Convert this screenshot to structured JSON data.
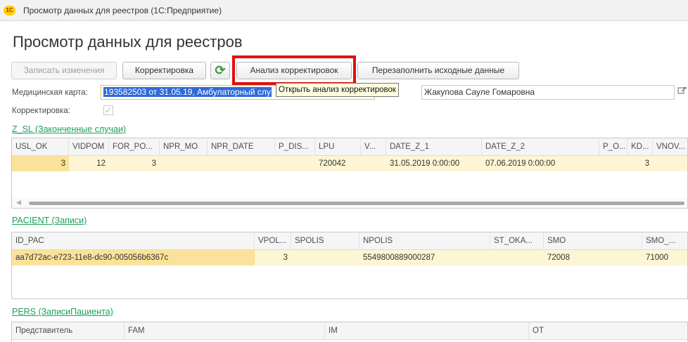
{
  "window": {
    "title": "Просмотр данных для реестров  (1С:Предприятие)",
    "app_icon_text": "1С"
  },
  "page": {
    "title": "Просмотр данных для реестров"
  },
  "toolbar": {
    "save_label": "Записать изменения",
    "correction_label": "Корректировка",
    "refresh_icon": "⟳",
    "analysis_label": "Анализ корректировок",
    "refill_label": "Перезаполнить исходные данные"
  },
  "tooltip": {
    "text": "Открыть анализ корректировок"
  },
  "form": {
    "medcard_label": "Медицинская карта:",
    "medcard_value": "193582503 от 31.05.19, Амбулаторный слу",
    "patient_value": "Жакупова Сауле Гомаровна",
    "correction_label": "Корректировка:",
    "correction_checked": true
  },
  "zsl": {
    "title": "Z_SL (Законченные случаи)",
    "columns": [
      "USL_OK",
      "VIDPOM",
      "FOR_PO...",
      "NPR_MO",
      "NPR_DATE",
      "P_DIS...",
      "LPU",
      "V...",
      "DATE_Z_1",
      "DATE_Z_2",
      "P_O...",
      "KD...",
      "VNOV..."
    ],
    "row": [
      "3",
      "12",
      "3",
      "",
      "",
      "",
      "720042",
      "",
      "31.05.2019 0:00:00",
      "07.06.2019 0:00:00",
      "",
      "3",
      ""
    ]
  },
  "pacient": {
    "title": "PACIENT (Записи)",
    "columns": [
      "ID_PAC",
      "VPOL...",
      "SPOLIS",
      "NPOLIS",
      "ST_OKA...",
      "SMO",
      "SMO_..."
    ],
    "row": [
      "aa7d72ac-e723-11e8-dc90-005056b6367c",
      "3",
      "",
      "5549800889000287",
      "",
      "72008",
      "71000"
    ]
  },
  "pers": {
    "title": "PERS (ЗаписиПациента)",
    "columns": [
      "Представитель",
      "FAM",
      "IM",
      "OT"
    ]
  },
  "colors": {
    "highlight": "#e01010",
    "link": "#1b9f5a",
    "row_bg": "#fdf5d3",
    "selection": "#2f6bd7"
  }
}
